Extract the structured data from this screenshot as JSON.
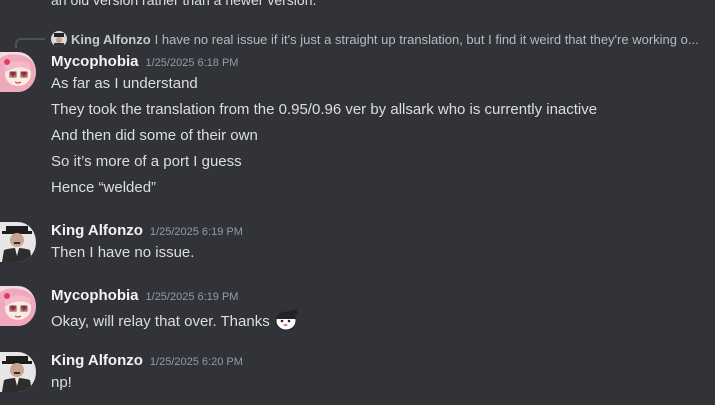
{
  "chat": {
    "clipped_line": "an old version rather than a newer version.",
    "reply": {
      "author": "King Alfonzo",
      "text": "I have no real issue if it's just a straight up translation, but I find it weird that they're working o..."
    },
    "messages": [
      {
        "author": "Mycophobia",
        "timestamp": "1/25/2025 6:18 PM",
        "avatar": "anime-girl-avatar",
        "lines": [
          "As far as I understand",
          "They took the translation from the 0.95/0.96 ver by allsark who is currently inactive",
          "And then did some of their own",
          "So it’s more of a port I guess",
          "Hence “welded”"
        ]
      },
      {
        "author": "King Alfonzo",
        "timestamp": "1/25/2025 6:19 PM",
        "avatar": "man-in-hat-avatar",
        "lines": [
          "Then I have no issue."
        ]
      },
      {
        "author": "Mycophobia",
        "timestamp": "1/25/2025 6:19 PM",
        "avatar": "anime-girl-avatar",
        "lines": [
          "Okay, will relay that over. Thanks"
        ],
        "emoji": "salute-emoji"
      },
      {
        "author": "King Alfonzo",
        "timestamp": "1/25/2025 6:20 PM",
        "avatar": "man-in-hat-avatar",
        "lines": [
          "np!"
        ]
      }
    ]
  }
}
